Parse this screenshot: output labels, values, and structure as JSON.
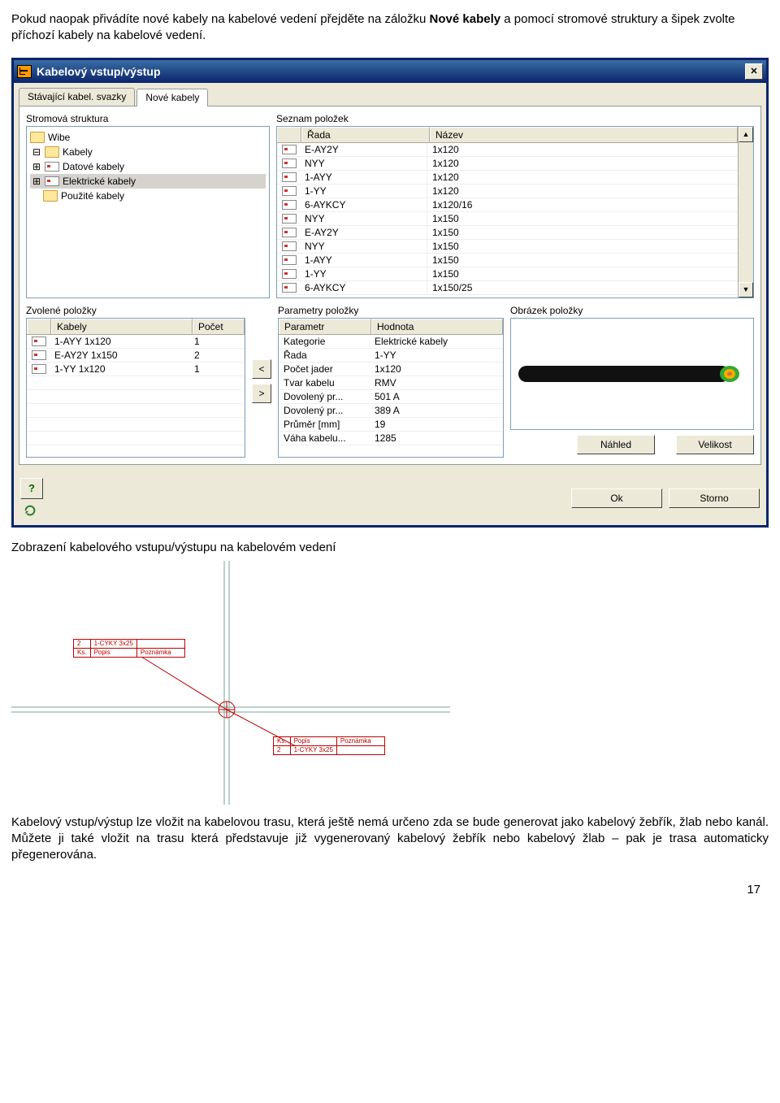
{
  "doc": {
    "intro_prefix": "Pokud naopak přivádíte nové kabely na kabelové vedení přejděte na záložku ",
    "intro_bold": "Nové kabely",
    "intro_suffix": " a pomocí stromové struktury a šipek zvolte příchozí kabely na kabelové vedení.",
    "caption_below_dialog": "Zobrazení kabelového vstupu/výstupu na kabelovém vedení",
    "bottom_para": "Kabelový vstup/výstup lze vložit na kabelovou trasu, která ještě nemá určeno zda se bude generovat jako kabelový žebřík, žlab nebo kanál. Můžete ji také vložit na trasu která představuje již vygenerovaný kabelový žebřík nebo kabelový žlab – pak je trasa automaticky přegenerována.",
    "page_number": "17"
  },
  "dialog": {
    "title": "Kabelový vstup/výstup",
    "tabs": {
      "existing": "Stávající kabel. svazky",
      "new": "Nové kabely"
    },
    "labels": {
      "tree": "Stromová struktura",
      "list": "Seznam položek",
      "list_col1": "Řada",
      "list_col2": "Název",
      "chosen": "Zvolené položky",
      "chosen_col1": "Kabely",
      "chosen_col2": "Počet",
      "params": "Parametry položky",
      "params_col1": "Parametr",
      "params_col2": "Hodnota",
      "image": "Obrázek položky",
      "btn_preview": "Náhled",
      "btn_size": "Velikost",
      "btn_ok": "Ok",
      "btn_cancel": "Storno",
      "btn_help": "?"
    },
    "tree": {
      "n0": "Wibe",
      "n1": "Kabely",
      "n2": "Datové kabely",
      "n3": "Elektrické kabely",
      "n4": "Použité kabely"
    },
    "list_items": [
      {
        "rada": "E-AY2Y",
        "nazev": "1x120"
      },
      {
        "rada": "NYY",
        "nazev": "1x120"
      },
      {
        "rada": "1-AYY",
        "nazev": "1x120"
      },
      {
        "rada": "1-YY",
        "nazev": "1x120"
      },
      {
        "rada": "6-AYKCY",
        "nazev": "1x120/16"
      },
      {
        "rada": "NYY",
        "nazev": "1x150"
      },
      {
        "rada": "E-AY2Y",
        "nazev": "1x150"
      },
      {
        "rada": "NYY",
        "nazev": "1x150"
      },
      {
        "rada": "1-AYY",
        "nazev": "1x150"
      },
      {
        "rada": "1-YY",
        "nazev": "1x150"
      },
      {
        "rada": "6-AYKCY",
        "nazev": "1x150/25"
      }
    ],
    "chosen_items": [
      {
        "kab": "1-AYY 1x120",
        "poc": "1"
      },
      {
        "kab": "E-AY2Y 1x150",
        "poc": "2"
      },
      {
        "kab": "1-YY 1x120",
        "poc": "1"
      }
    ],
    "params": [
      {
        "p": "Kategorie",
        "h": "Elektrické kabely"
      },
      {
        "p": "Řada",
        "h": "1-YY"
      },
      {
        "p": "Počet jader",
        "h": "1x120"
      },
      {
        "p": "Tvar kabelu",
        "h": "RMV"
      },
      {
        "p": "Dovolený pr...",
        "h": "501 A"
      },
      {
        "p": "Dovolený pr...",
        "h": "389 A"
      },
      {
        "p": "Průměr [mm]",
        "h": "19"
      },
      {
        "p": "Váha kabelu...",
        "h": "1285"
      }
    ]
  },
  "mini": {
    "ks": "Ks.",
    "popis": "Popis",
    "pozn": "Poznámka",
    "r1_ks": "2",
    "r1_pop": "1-CYKY 3x25"
  }
}
